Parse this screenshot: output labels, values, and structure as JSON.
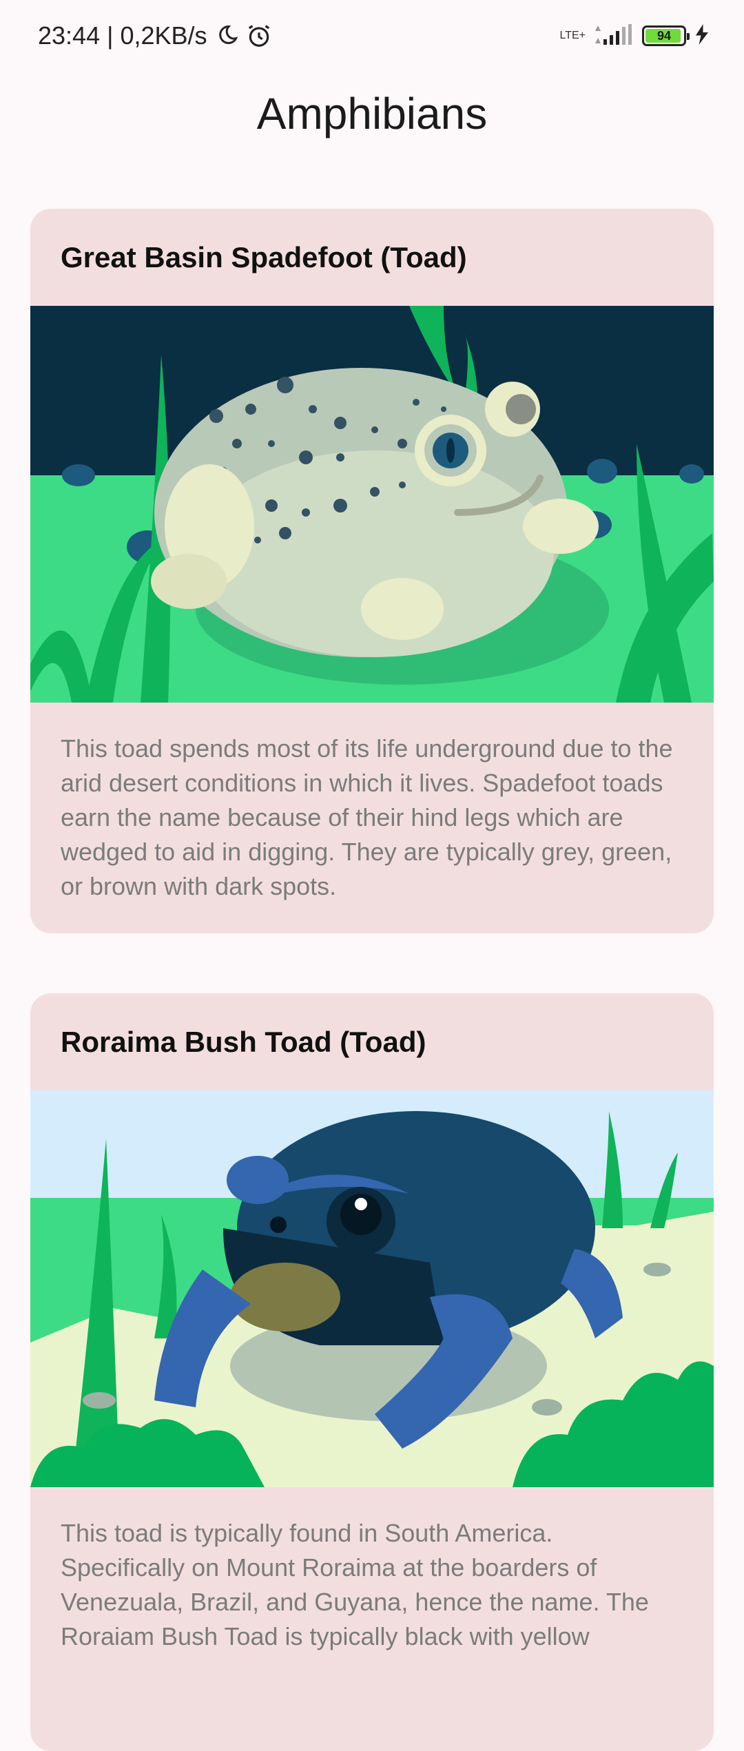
{
  "status_bar": {
    "time": "23:44",
    "net_speed": "0,2KB/s",
    "network": "LTE+",
    "battery_level": "94"
  },
  "page": {
    "title": "Amphibians"
  },
  "cards": [
    {
      "title": "Great Basin Spadefoot (Toad)",
      "description": "This toad spends most of its life underground due to the arid desert conditions in which it lives. Spadefoot toads earn the name because of their hind legs which are wedged to aid in digging. They are typically grey, green, or brown with dark spots."
    },
    {
      "title": "Roraima Bush Toad (Toad)",
      "description": "This toad is typically found in South America. Specifically on Mount Roraima at the boarders of Venezuala, Brazil, and Guyana, hence the name. The Roraiam Bush Toad is typically black with yellow"
    }
  ],
  "colors": {
    "card_background": "#f3dedf",
    "page_background": "#fdf8f9",
    "description_text": "#7b7b7b"
  }
}
